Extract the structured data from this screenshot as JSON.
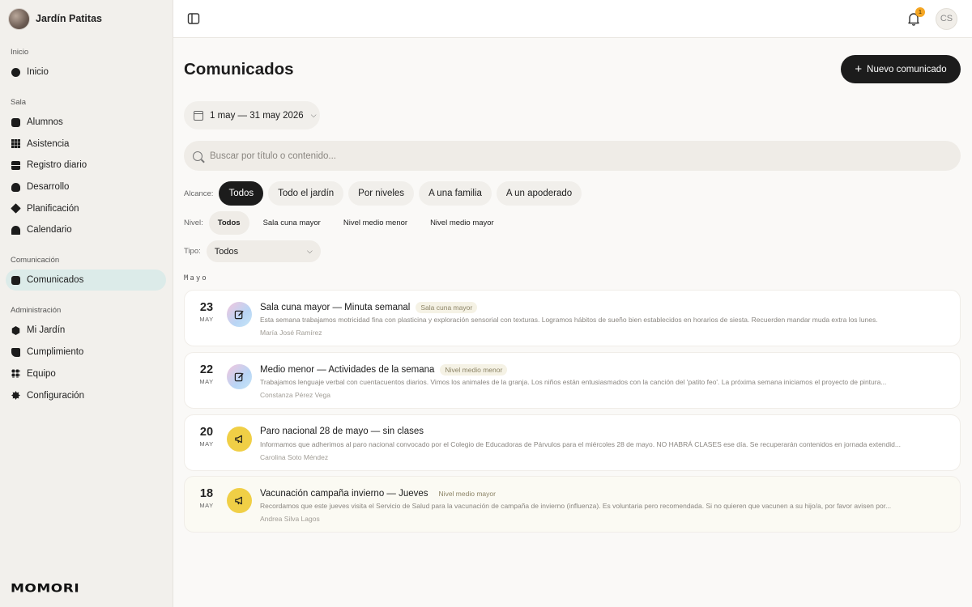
{
  "app": {
    "name": "Jardín Patitas",
    "logo_text": "MOMORI"
  },
  "sidebar": {
    "sections": [
      {
        "label": "Inicio",
        "items": [
          {
            "label": "Inicio",
            "icon": "circle-icon"
          }
        ]
      },
      {
        "label": "Sala",
        "items": [
          {
            "label": "Alumnos",
            "icon": "rounded-square-icon"
          },
          {
            "label": "Asistencia",
            "icon": "grid-icon"
          },
          {
            "label": "Registro diario",
            "icon": "bars-icon"
          },
          {
            "label": "Desarrollo",
            "icon": "club-icon"
          },
          {
            "label": "Planificación",
            "icon": "diamond-icon"
          },
          {
            "label": "Calendario",
            "icon": "arch-icon"
          }
        ]
      },
      {
        "label": "Comunicación",
        "items": [
          {
            "label": "Comunicados",
            "icon": "rounded-square-icon",
            "active": true
          }
        ]
      },
      {
        "label": "Administración",
        "items": [
          {
            "label": "Mi Jardín",
            "icon": "hexagon-icon"
          },
          {
            "label": "Cumplimiento",
            "icon": "flag-icon"
          },
          {
            "label": "Equipo",
            "icon": "four-dots-icon"
          },
          {
            "label": "Configuración",
            "icon": "gear-icon"
          }
        ]
      }
    ]
  },
  "topbar": {
    "notifications_count": "1",
    "user_initials": "CS"
  },
  "main": {
    "title": "Comunicados",
    "new_button": "Nuevo comunicado",
    "date_range": "1 may — 31 may 2026",
    "search_placeholder": "Buscar por título o contenido...",
    "alcance": {
      "label": "Alcance:",
      "options": [
        "Todos",
        "Todo el jardín",
        "Por niveles",
        "A una familia",
        "A un apoderado"
      ],
      "selected": "Todos"
    },
    "nivel": {
      "label": "Nivel:",
      "options": [
        "Todos",
        "Sala cuna mayor",
        "Nivel medio menor",
        "Nivel medio mayor"
      ],
      "selected": "Todos"
    },
    "tipo": {
      "label": "Tipo:",
      "value": "Todos"
    },
    "month_heading": "Mayo",
    "items": [
      {
        "day": "23",
        "month": "MAY",
        "icon": "edit-icon",
        "title": "Sala cuna mayor — Minuta semanal",
        "tag": "Sala cuna mayor",
        "excerpt": "Esta semana trabajamos motricidad fina con plasticina y exploración sensorial con texturas. Logramos hábitos de sueño bien establecidos en horarios de siesta. Recuerden mandar muda extra los lunes.",
        "author": "María José Ramírez"
      },
      {
        "day": "22",
        "month": "MAY",
        "icon": "edit-icon",
        "title": "Medio menor — Actividades de la semana",
        "tag": "Nivel medio menor",
        "excerpt": "Trabajamos lenguaje verbal con cuentacuentos diarios. Vimos los animales de la granja. Los niños están entusiasmados con la canción del 'patito feo'. La próxima semana iniciamos el proyecto de pintura...",
        "author": "Constanza Pérez Vega"
      },
      {
        "day": "20",
        "month": "MAY",
        "icon": "megaphone-icon",
        "title": "Paro nacional 28 de mayo — sin clases",
        "tag": "",
        "excerpt": "Informamos que adherimos al paro nacional convocado por el Colegio de Educadoras de Párvulos para el miércoles 28 de mayo. NO HABRÁ CLASES ese día. Se recuperarán contenidos en jornada extendid...",
        "author": "Carolina Soto Méndez"
      },
      {
        "day": "18",
        "month": "MAY",
        "icon": "megaphone-icon",
        "title": "Vacunación campaña invierno — Jueves",
        "tag": "Nivel medio mayor",
        "excerpt": "Recordamos que este jueves visita el Servicio de Salud para la vacunación de campaña de invierno (influenza). Es voluntaria pero recomendada. Si no quieren que vacunen a su hijo/a, por favor avisen por...",
        "author": "Andrea Silva Lagos"
      }
    ]
  }
}
